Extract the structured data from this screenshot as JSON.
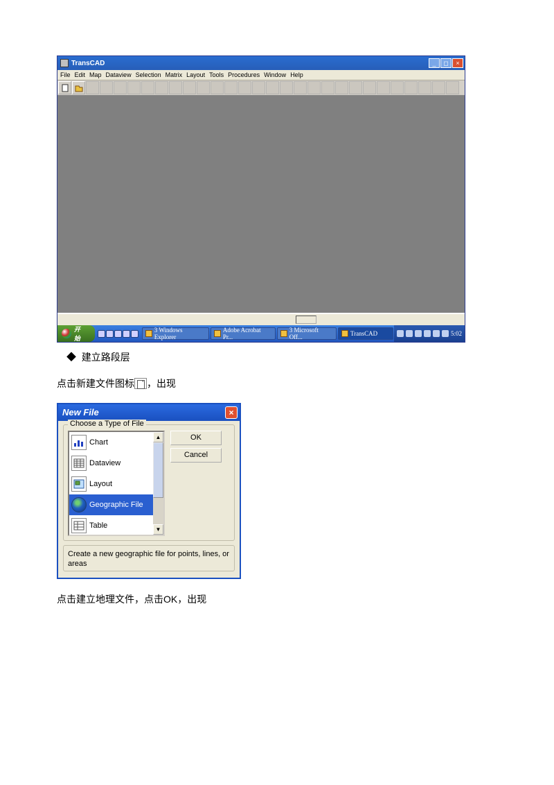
{
  "app": {
    "title": "TransCAD",
    "menus": [
      "File",
      "Edit",
      "Map",
      "Dataview",
      "Selection",
      "Matrix",
      "Layout",
      "Tools",
      "Procedures",
      "Window",
      "Help"
    ]
  },
  "taskbar": {
    "start": "开始",
    "apps": [
      {
        "label": "3 Windows Explorer"
      },
      {
        "label": "Adobe Acrobat Pr..."
      },
      {
        "label": "3 Microsoft Off..."
      },
      {
        "label": "TransCAD"
      }
    ],
    "clock": "5:02"
  },
  "body": {
    "bullet1": "建立路段层",
    "line1_pre": "点击新建文件图标",
    "line1_post": "，出现",
    "line2": "点击建立地理文件，点击OK，出现"
  },
  "dialog": {
    "title": "New File",
    "group_label": "Choose a Type of File",
    "items": [
      {
        "label": "Chart"
      },
      {
        "label": "Dataview"
      },
      {
        "label": "Layout"
      },
      {
        "label": "Geographic File",
        "selected": true
      },
      {
        "label": "Table"
      }
    ],
    "ok": "OK",
    "cancel": "Cancel",
    "description": "Create a new geographic file for points, lines, or areas"
  }
}
